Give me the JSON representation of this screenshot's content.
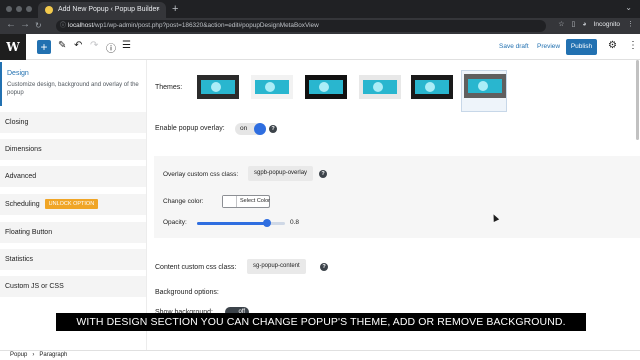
{
  "browser": {
    "tab_title": "Add New Popup ‹ Popup Builder",
    "tab_close": "×",
    "new_tab": "+",
    "url_host": "localhost",
    "url_path": "/wp1/wp-admin/post.php?post=186320&action=edit#popupDesignMetaBoxView",
    "profile_label": "Incognito",
    "back": "←",
    "forward": "→",
    "reload": "C"
  },
  "toolbar": {
    "add_block": "+",
    "save_draft": "Save draft",
    "preview": "Preview",
    "publish": "Publish"
  },
  "sidebar": {
    "active": {
      "title": "Design",
      "description": "Customize design, background and overlay of the popup"
    },
    "items": [
      {
        "label": "Closing"
      },
      {
        "label": "Dimensions"
      },
      {
        "label": "Advanced"
      },
      {
        "label": "Scheduling",
        "badge": "UNLOCK OPTION"
      },
      {
        "label": "Floating Button"
      },
      {
        "label": "Statistics"
      },
      {
        "label": "Custom JS or CSS"
      }
    ]
  },
  "design": {
    "themes_label": "Themes:",
    "themes": [
      {
        "frame": "#2b2b2b",
        "band": "#29b6cf"
      },
      {
        "frame": "#f2f2f2",
        "band": "#29b6cf"
      },
      {
        "frame": "#111111",
        "band": "#29b6cf"
      },
      {
        "frame": "#e8e8e8",
        "band": "#29b6cf"
      },
      {
        "frame": "#1a1a1a",
        "band": "#29b6cf"
      },
      {
        "frame": "#5f5f5f",
        "band": "#29b6cf",
        "selected": true
      }
    ],
    "overlay_label": "Enable popup overlay:",
    "overlay_state": "on",
    "overlay_css_label": "Overlay custom css class:",
    "overlay_css_value": "sgpb-popup-overlay",
    "change_color_label": "Change color:",
    "select_color": "Select Color",
    "opacity_label": "Opacity:",
    "opacity_value": "0.8",
    "opacity": 0.8,
    "content_css_label": "Content custom css class:",
    "content_css_value": "sg-popup-content",
    "bg_options_label": "Background options:",
    "show_bg_label": "Show background:",
    "show_bg_state": "off",
    "help": "?"
  },
  "caption": "WITH DESIGN SECTION YOU CAN CHANGE POPUP'S THEME, ADD OR REMOVE BACKGROUND.",
  "footer": {
    "crumb1": "Popup",
    "separator": "›",
    "crumb2": "Paragraph"
  },
  "colors": {
    "accent": "#2271b1",
    "toggle_on": "#2f6ee0",
    "badge": "#f0a526"
  }
}
